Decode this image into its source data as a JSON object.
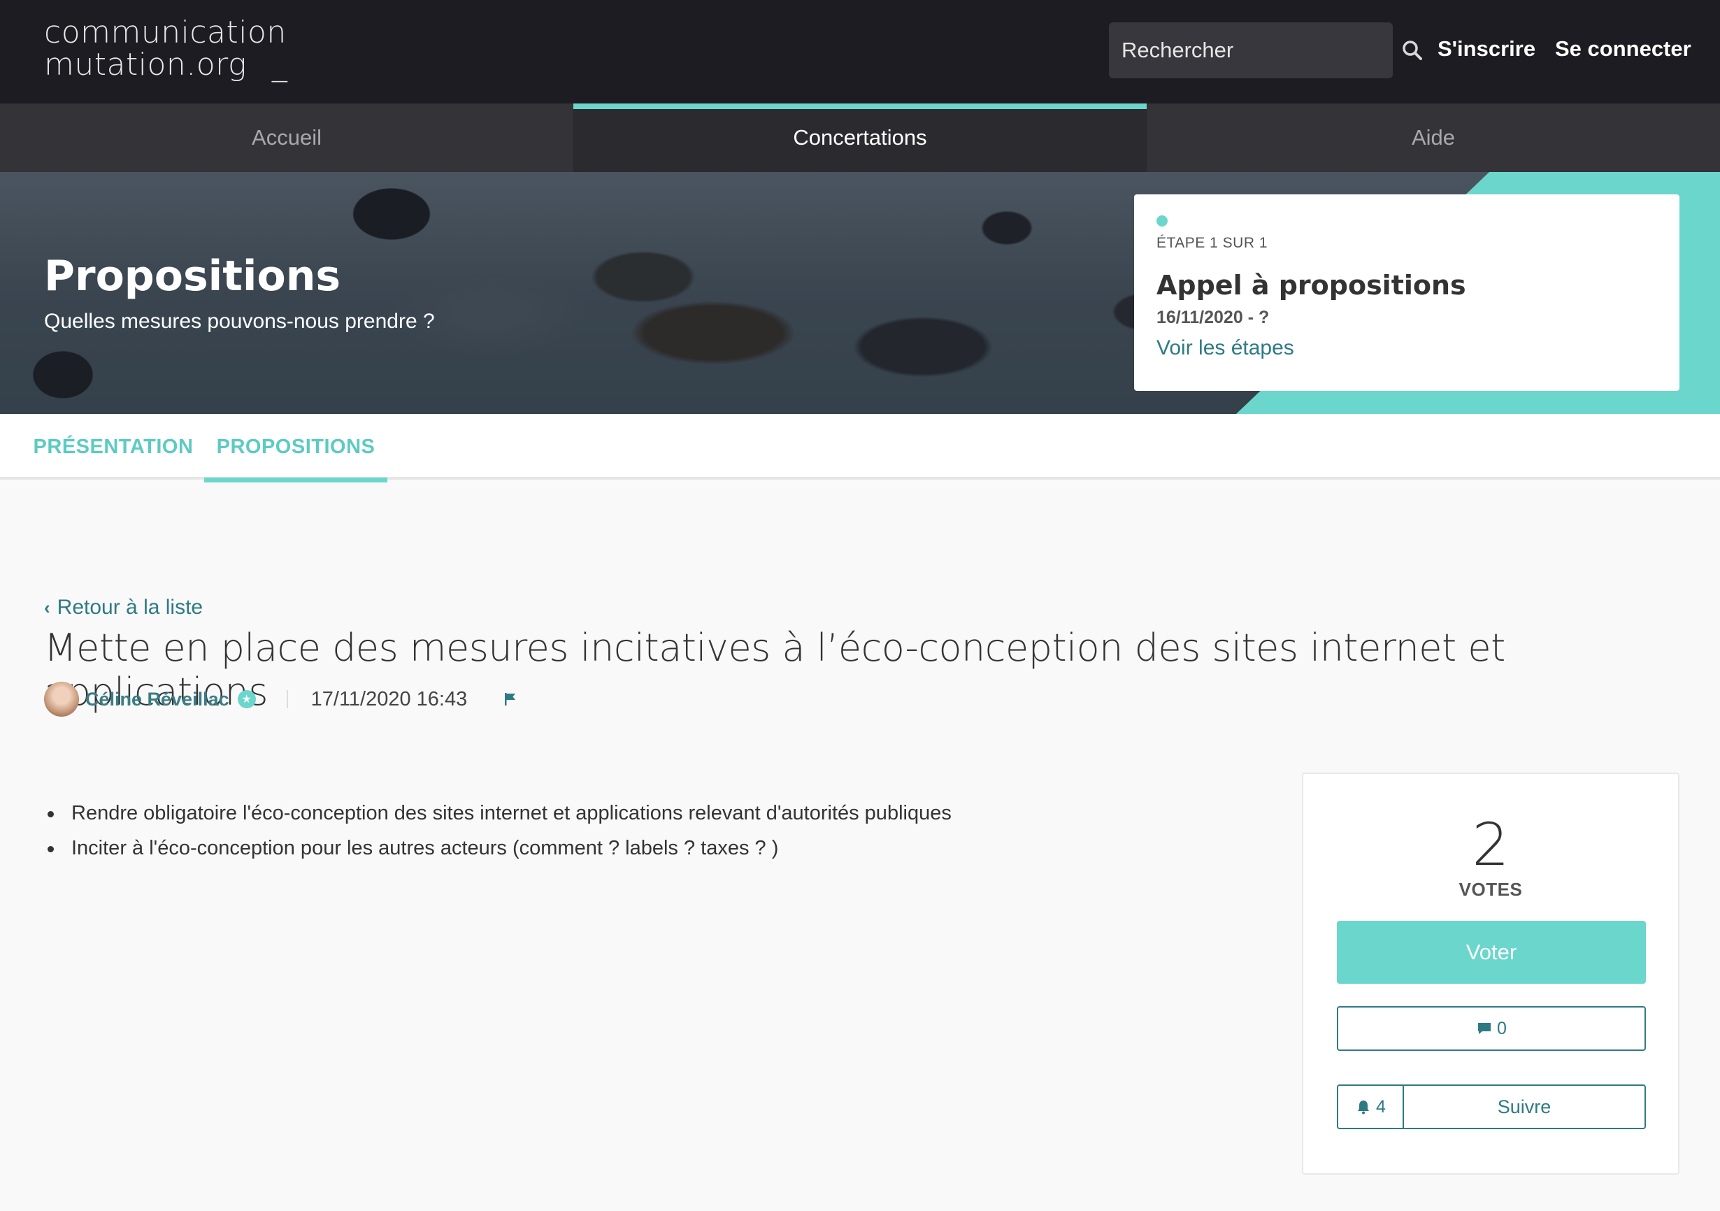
{
  "header": {
    "logo_line1": "communication",
    "logo_line2": "mutation.org",
    "logo_cursor": "_",
    "search_placeholder": "Rechercher",
    "signup_label": "S'inscrire",
    "login_label": "Se connecter"
  },
  "nav": {
    "items": [
      {
        "label": "Accueil",
        "active": false
      },
      {
        "label": "Concertations",
        "active": true
      },
      {
        "label": "Aide",
        "active": false
      }
    ]
  },
  "hero": {
    "title": "Propositions",
    "subtitle": "Quelles mesures pouvons-nous prendre ?"
  },
  "step": {
    "count": "ÉTAPE 1 SUR 1",
    "name": "Appel à propositions",
    "dates": "16/11/2020 - ?",
    "link": "Voir les étapes"
  },
  "tabs": {
    "items": [
      {
        "label": "PRÉSENTATION",
        "active": false
      },
      {
        "label": "PROPOSITIONS",
        "active": true
      }
    ]
  },
  "proposal": {
    "back_label": "Retour à la liste",
    "title": "Mette en place des mesures incitatives à l’éco-conception des sites internet et applications",
    "author": "Céline Réveillac",
    "date": "17/11/2020 16:43",
    "body": [
      "Rendre obligatoire l'éco-conception des sites internet et applications relevant d'autorités publiques",
      "Inciter à l'éco-conception pour les autres acteurs (comment ? labels ? taxes ? )"
    ]
  },
  "votes": {
    "count": "2",
    "label": "VOTES",
    "vote_button": "Voter",
    "comments_count": "0",
    "followers_count": "4",
    "follow_button": "Suivre"
  },
  "colors": {
    "accent": "#6bd6cc",
    "link": "#2e7a84",
    "header_bg": "#1d1c22",
    "nav_bg": "#333338"
  },
  "icons": [
    "search-icon",
    "chevron-left-icon",
    "star-badge-icon",
    "flag-icon",
    "comment-icon",
    "bell-icon",
    "step-dot-icon"
  ]
}
